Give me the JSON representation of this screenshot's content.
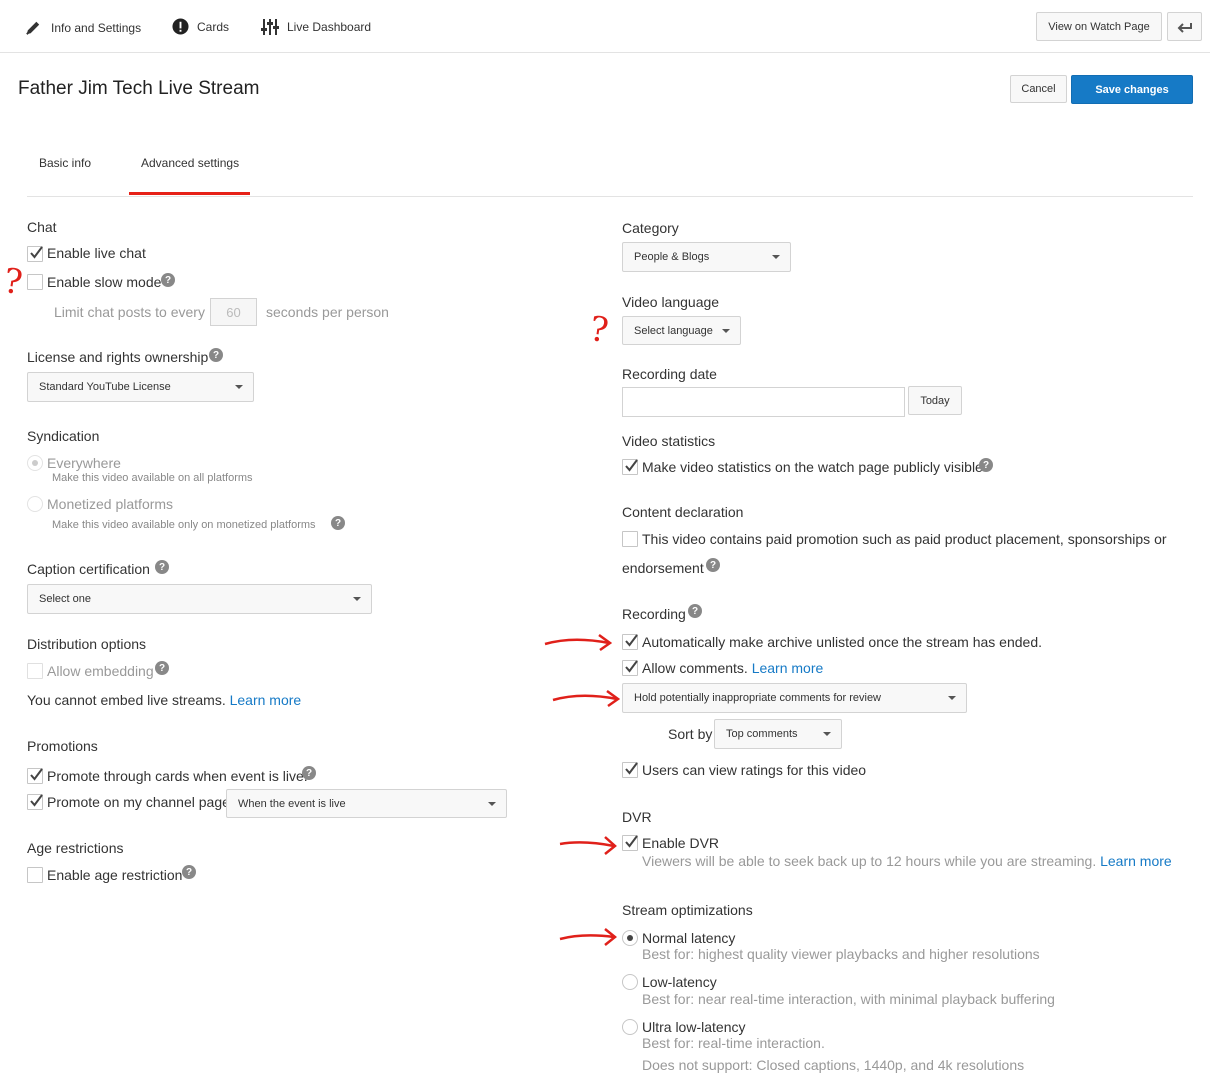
{
  "topnav": {
    "info": "Info and Settings",
    "cards": "Cards",
    "live": "Live Dashboard",
    "view_watch": "View on Watch Page"
  },
  "header": {
    "title": "Father Jim Tech Live Stream",
    "cancel": "Cancel",
    "save": "Save changes"
  },
  "tabs": {
    "basic": "Basic info",
    "advanced": "Advanced settings"
  },
  "chat": {
    "title": "Chat",
    "enable_live": "Enable live chat",
    "enable_slow": "Enable slow mode",
    "limit_prefix": "Limit chat posts to every",
    "limit_value": "60",
    "limit_suffix": "seconds per person"
  },
  "license": {
    "title": "License and rights ownership",
    "value": "Standard YouTube License"
  },
  "syndication": {
    "title": "Syndication",
    "everywhere": "Everywhere",
    "everywhere_desc": "Make this video available on all platforms",
    "monetized": "Monetized platforms",
    "monetized_desc": "Make this video available only on monetized platforms"
  },
  "caption": {
    "title": "Caption certification",
    "value": "Select one"
  },
  "distribution": {
    "title": "Distribution options",
    "allow_embedding": "Allow embedding",
    "note": "You cannot embed live streams.",
    "learn": "Learn more"
  },
  "promotions": {
    "title": "Promotions",
    "cards": "Promote through cards when event is live.",
    "channel": "Promote on my channel page",
    "channel_value": "When the event is live"
  },
  "age": {
    "title": "Age restrictions",
    "enable": "Enable age restriction"
  },
  "category": {
    "title": "Category",
    "value": "People & Blogs"
  },
  "language": {
    "title": "Video language",
    "value": "Select language"
  },
  "recording_date": {
    "title": "Recording date",
    "today": "Today"
  },
  "stats": {
    "title": "Video statistics",
    "label": "Make video statistics on the watch page publicly visible"
  },
  "content": {
    "title": "Content declaration",
    "line1": "This video contains paid promotion such as paid product placement, sponsorships or",
    "line2": "endorsement"
  },
  "recording": {
    "title": "Recording",
    "archive": "Automatically make archive unlisted once the stream has ended.",
    "allow_comments": "Allow comments.",
    "learn": "Learn more",
    "hold": "Hold potentially inappropriate comments for review",
    "sort_by": "Sort by",
    "sort_value": "Top comments",
    "ratings": "Users can view ratings for this video"
  },
  "dvr": {
    "title": "DVR",
    "enable": "Enable DVR",
    "desc": "Viewers will be able to seek back up to 12 hours while you are streaming.",
    "learn": "Learn more"
  },
  "stream": {
    "title": "Stream optimizations",
    "normal": "Normal latency",
    "normal_desc": "Best for: highest quality viewer playbacks and higher resolutions",
    "low": "Low-latency",
    "low_desc": "Best for: near real-time interaction, with minimal playback buffering",
    "ultra": "Ultra low-latency",
    "ultra_desc": "Best for: real-time interaction.",
    "ultra_note": "Does not support: Closed captions, 1440p, and 4k resolutions"
  },
  "annotations": {
    "q": "?"
  },
  "colors": {
    "accent": "#167ac6",
    "tab_underline": "#e62117",
    "annotation": "#e0201a"
  }
}
